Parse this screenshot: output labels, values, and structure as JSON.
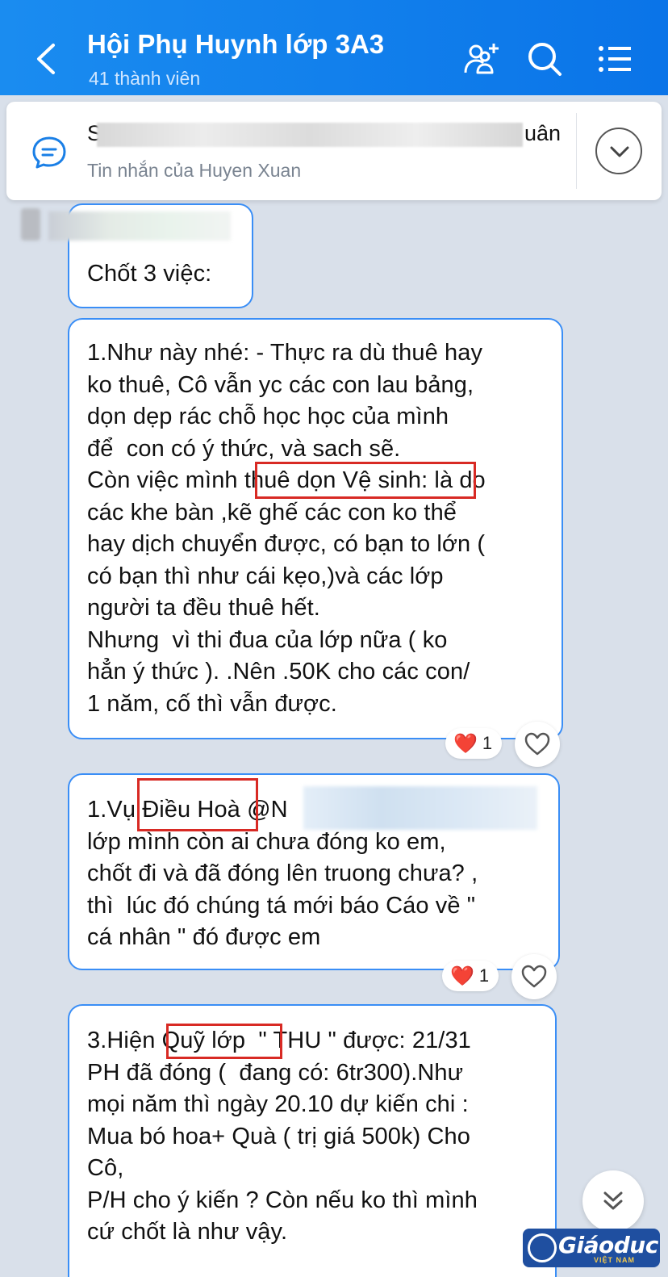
{
  "header": {
    "title": "Hội Phụ Huynh lớp 3A3",
    "members": "41 thành viên",
    "back_icon": "chevron-left-icon",
    "add_member_icon": "add-member-icon",
    "search_icon": "search-icon",
    "menu_icon": "menu-icon"
  },
  "pinned": {
    "preview_start": "S",
    "preview_end": "uân",
    "subtitle": "Tin nhắn của Huyen Xuan",
    "icon": "chat-bubble-icon",
    "expand_icon": "chevron-down-icon"
  },
  "messages": [
    {
      "text": "Chốt 3 việc:"
    },
    {
      "text": "1.Như này nhé: - Thực ra dù thuê hay\nko thuê, Cô vẫn yc các con lau bảng,\ndọn dẹp rác chỗ học học của mình\nđể  con có ý thức, và sach sẽ.\nCòn việc mình thuê dọn Vệ sinh: là do\ncác khe bàn ,kẽ ghế các con ko thể\nhay dịch chuyển được, có bạn to lớn (\ncó bạn thì như cái kẹo,)và các lớp\nngười ta đều thuê hết.\nNhưng  vì thi đua của lớp nữa ( ko\nhẳn ý thức ). .Nên .50K cho các con/\n1 năm, cố thì vẫn được.",
      "reaction_count": "1"
    },
    {
      "text": "1.Vụ Điều Hoà @N\nlớp mình còn ai chưa đóng ko em,\nchốt đi và đã đóng lên truong chưa? ,\nthì  lúc đó chúng tá mới báo Cáo về \"\ncá nhân \" đó được em",
      "reaction_count": "1"
    },
    {
      "text": "3.Hiện Quỹ lớp  \" THU \" được: 21/31\nPH đã đóng (  đang có: 6tr300).Như\nmọi năm thì ngày 20.10 dự kiến chi :\nMua bó hoa+ Quà ( trị giá 500k) Cho\nCô,\nP/H cho ý kiến ? Còn nếu ko thì mình\ncứ chốt là như vậy."
    }
  ],
  "reaction_emoji": "❤️",
  "watermark": {
    "text": "Giáoduc",
    "sub": "VIỆT NAM"
  },
  "colors": {
    "header": "#0a74e8",
    "bubble_border": "#3a8ef6",
    "highlight": "#d82a24",
    "background": "#d9e0ea"
  }
}
